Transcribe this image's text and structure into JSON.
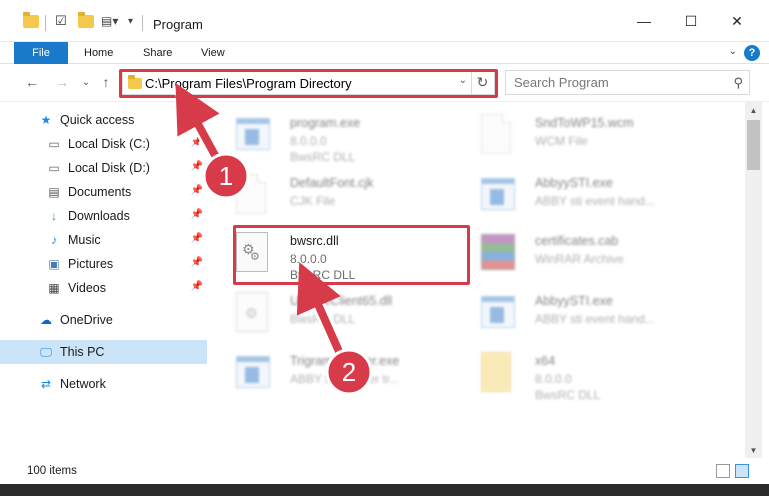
{
  "window": {
    "title": "Program",
    "controls": {
      "minimize": "—",
      "maximize": "☐",
      "close": "✕"
    }
  },
  "ribbon": {
    "tabs": [
      "File",
      "Home",
      "Share",
      "View"
    ],
    "help": "?"
  },
  "address": {
    "path": "C:\\Program Files\\Program Directory"
  },
  "search": {
    "placeholder": "Search Program"
  },
  "nav": {
    "quick_access": "Quick access",
    "items": [
      {
        "label": "Local Disk (C:)",
        "icon": "drive-icon"
      },
      {
        "label": "Local Disk (D:)",
        "icon": "drive-icon"
      },
      {
        "label": "Documents",
        "icon": "documents-icon"
      },
      {
        "label": "Downloads",
        "icon": "download-icon"
      },
      {
        "label": "Music",
        "icon": "music-icon"
      },
      {
        "label": "Pictures",
        "icon": "pictures-icon"
      },
      {
        "label": "Videos",
        "icon": "videos-icon"
      }
    ],
    "onedrive": "OneDrive",
    "this_pc": "This PC",
    "network": "Network"
  },
  "files": [
    {
      "name": "program.exe",
      "version": "8.0.0.0",
      "desc": "BwsRC DLL",
      "icon": "exe-icon",
      "blurred": true
    },
    {
      "name": "SndToWP15.wcm",
      "version": "WCM File",
      "desc": "",
      "icon": "document-icon",
      "blurred": true
    },
    {
      "name": "DefaultFont.cjk",
      "version": "CJK File",
      "desc": "",
      "icon": "document-icon",
      "blurred": true
    },
    {
      "name": "AbbyySTI.exe",
      "version": "ABBY sti event hand...",
      "desc": "",
      "icon": "exe-icon",
      "blurred": true
    },
    {
      "name": "bwsrc.dll",
      "version": "8.0.0.0",
      "desc": "BwsRC DLL",
      "icon": "dll-gear-icon",
      "blurred": false
    },
    {
      "name": "certificates.cab",
      "version": "WinRAR Archive",
      "desc": "",
      "icon": "winrar-icon",
      "blurred": true
    },
    {
      "name": "UpdateClient65.dll",
      "version": "BwsRC DLL",
      "desc": "",
      "icon": "dll-gear-icon",
      "blurred": true
    },
    {
      "name": "AbbyySTI.exe",
      "version": "ABBY sti event hand...",
      "desc": "",
      "icon": "exe-icon",
      "blurred": true
    },
    {
      "name": "TrigramInstaller.exe",
      "version": "ABBY finereader tr...",
      "desc": "",
      "icon": "exe-icon",
      "blurred": true
    },
    {
      "name": "x64",
      "version": "8.0.0.0",
      "desc": "BwsRC DLL",
      "icon": "folder-icon",
      "blurred": true
    }
  ],
  "status": {
    "count": "100 items"
  },
  "annotations": {
    "step1": "1",
    "step2": "2",
    "color": "#d73b4a"
  }
}
